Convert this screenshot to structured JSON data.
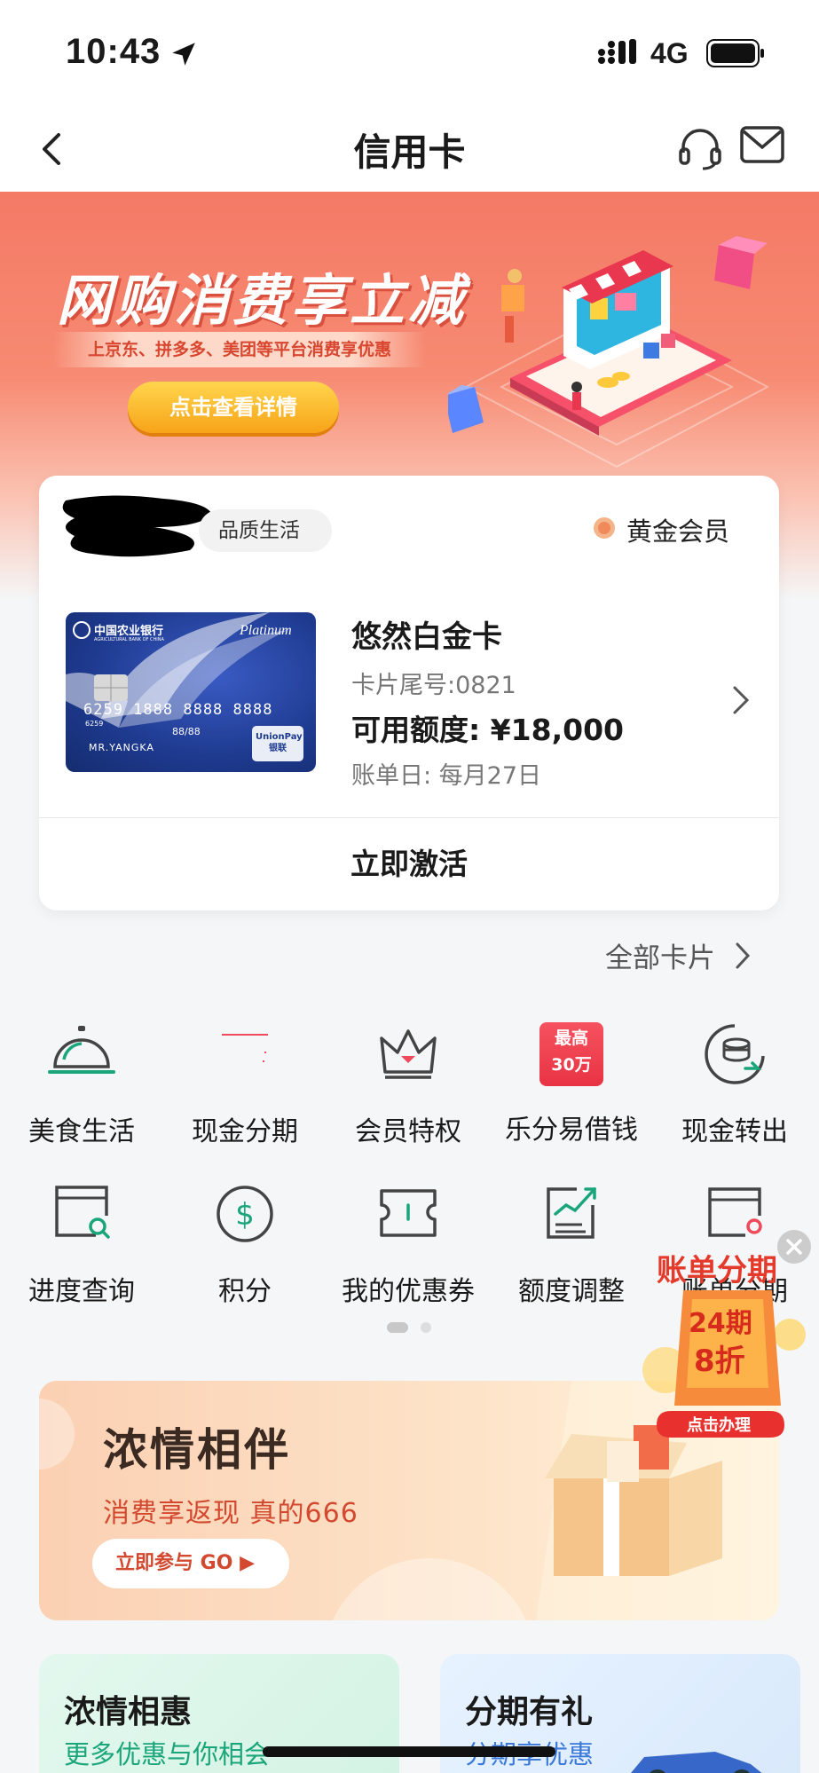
{
  "status": {
    "time": "10:43",
    "network": "4G"
  },
  "nav": {
    "title": "信用卡"
  },
  "hero": {
    "title": "网购消费享立减",
    "subtitle": "上京东、拼多多、美团等平台消费享优惠",
    "button": "点击查看详情"
  },
  "card": {
    "tier_tag": "品质生活",
    "member_level": "黄金会员",
    "name": "悠然白金卡",
    "tail": "卡片尾号:0821",
    "limit": "可用额度: ¥18,000",
    "bill_day": "账单日: 每月27日",
    "activate": "立即激活",
    "image": {
      "bank": "中国农业银行",
      "bank_en": "AGRICULTURAL BANK OF CHINA",
      "tier": "Platinum",
      "number": "6259 1888 8888 8888",
      "number_prefix": "6259",
      "valid": "88/88",
      "holder": "MR.YANGKA",
      "network": "UnionPay 银联"
    }
  },
  "all_cards": "全部卡片",
  "grid": [
    {
      "label": "美食生活",
      "icon": "dining-cloche-icon"
    },
    {
      "label": "现金分期",
      "icon": "cash-installment-icon"
    },
    {
      "label": "会员特权",
      "icon": "crown-icon"
    },
    {
      "label": "乐分易借钱",
      "icon": "loan-badge-icon",
      "badge": [
        "最高",
        "30万"
      ]
    },
    {
      "label": "现金转出",
      "icon": "coins-transfer-icon"
    },
    {
      "label": "进度查询",
      "icon": "progress-search-icon"
    },
    {
      "label": "积分",
      "icon": "points-dollar-icon"
    },
    {
      "label": "我的优惠券",
      "icon": "coupon-icon"
    },
    {
      "label": "额度调整",
      "icon": "limit-chart-icon"
    },
    {
      "label": "账单分期",
      "icon": "bill-settings-icon"
    }
  ],
  "float_promo": {
    "title": "账单分期",
    "period": "24期",
    "discount": "8折",
    "button": "点击办理"
  },
  "promo": {
    "title": "浓情相伴",
    "subtitle": "消费享返现 真的666",
    "button": "立即参与 GO ▶"
  },
  "bottom_cards": [
    {
      "title": "浓情相惠",
      "subtitle": "更多优惠与你相会"
    },
    {
      "title": "分期有礼",
      "subtitle": "分期享优惠"
    }
  ],
  "colors": {
    "accent_red": "#d2492f",
    "hero_bg": "#f47a66",
    "icon_green": "#1aa57a"
  }
}
